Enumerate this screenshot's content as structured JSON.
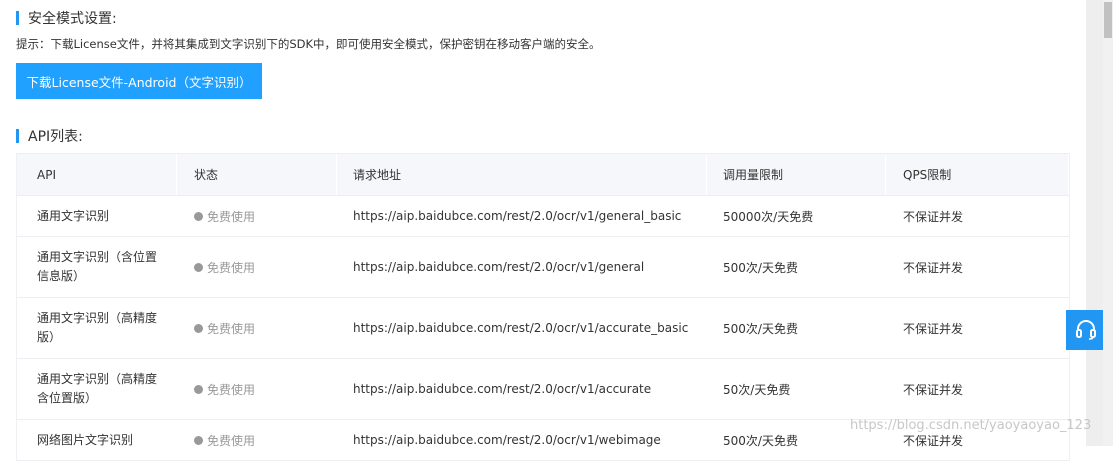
{
  "security": {
    "title": "安全模式设置:",
    "hint": "提示：下载License文件，并将其集成到文字识别下的SDK中，即可使用安全模式，保护密钥在移动客户端的安全。",
    "download_label": "下载License文件-Android（文字识别）"
  },
  "api": {
    "title": "API列表:",
    "headers": [
      "API",
      "状态",
      "请求地址",
      "调用量限制",
      "QPS限制"
    ],
    "rows": [
      {
        "name": "通用文字识别",
        "status": "免费使用",
        "url": "https://aip.baidubce.com/rest/2.0/ocr/v1/general_basic",
        "limit": "50000次/天免费",
        "qps": "不保证并发"
      },
      {
        "name": "通用文字识别（含位置信息版）",
        "status": "免费使用",
        "url": "https://aip.baidubce.com/rest/2.0/ocr/v1/general",
        "limit": "500次/天免费",
        "qps": "不保证并发"
      },
      {
        "name": "通用文字识别（高精度版）",
        "status": "免费使用",
        "url": "https://aip.baidubce.com/rest/2.0/ocr/v1/accurate_basic",
        "limit": "500次/天免费",
        "qps": "不保证并发"
      },
      {
        "name": "通用文字识别（高精度含位置版）",
        "status": "免费使用",
        "url": "https://aip.baidubce.com/rest/2.0/ocr/v1/accurate",
        "limit": "50次/天免费",
        "qps": "不保证并发"
      },
      {
        "name": "网络图片文字识别",
        "status": "免费使用",
        "url": "https://aip.baidubce.com/rest/2.0/ocr/v1/webimage",
        "limit": "500次/天免费",
        "qps": "不保证并发"
      }
    ]
  },
  "watermark": "https://blog.csdn.net/yaoyaoyao_123",
  "icons": {
    "help": "headset-icon"
  }
}
